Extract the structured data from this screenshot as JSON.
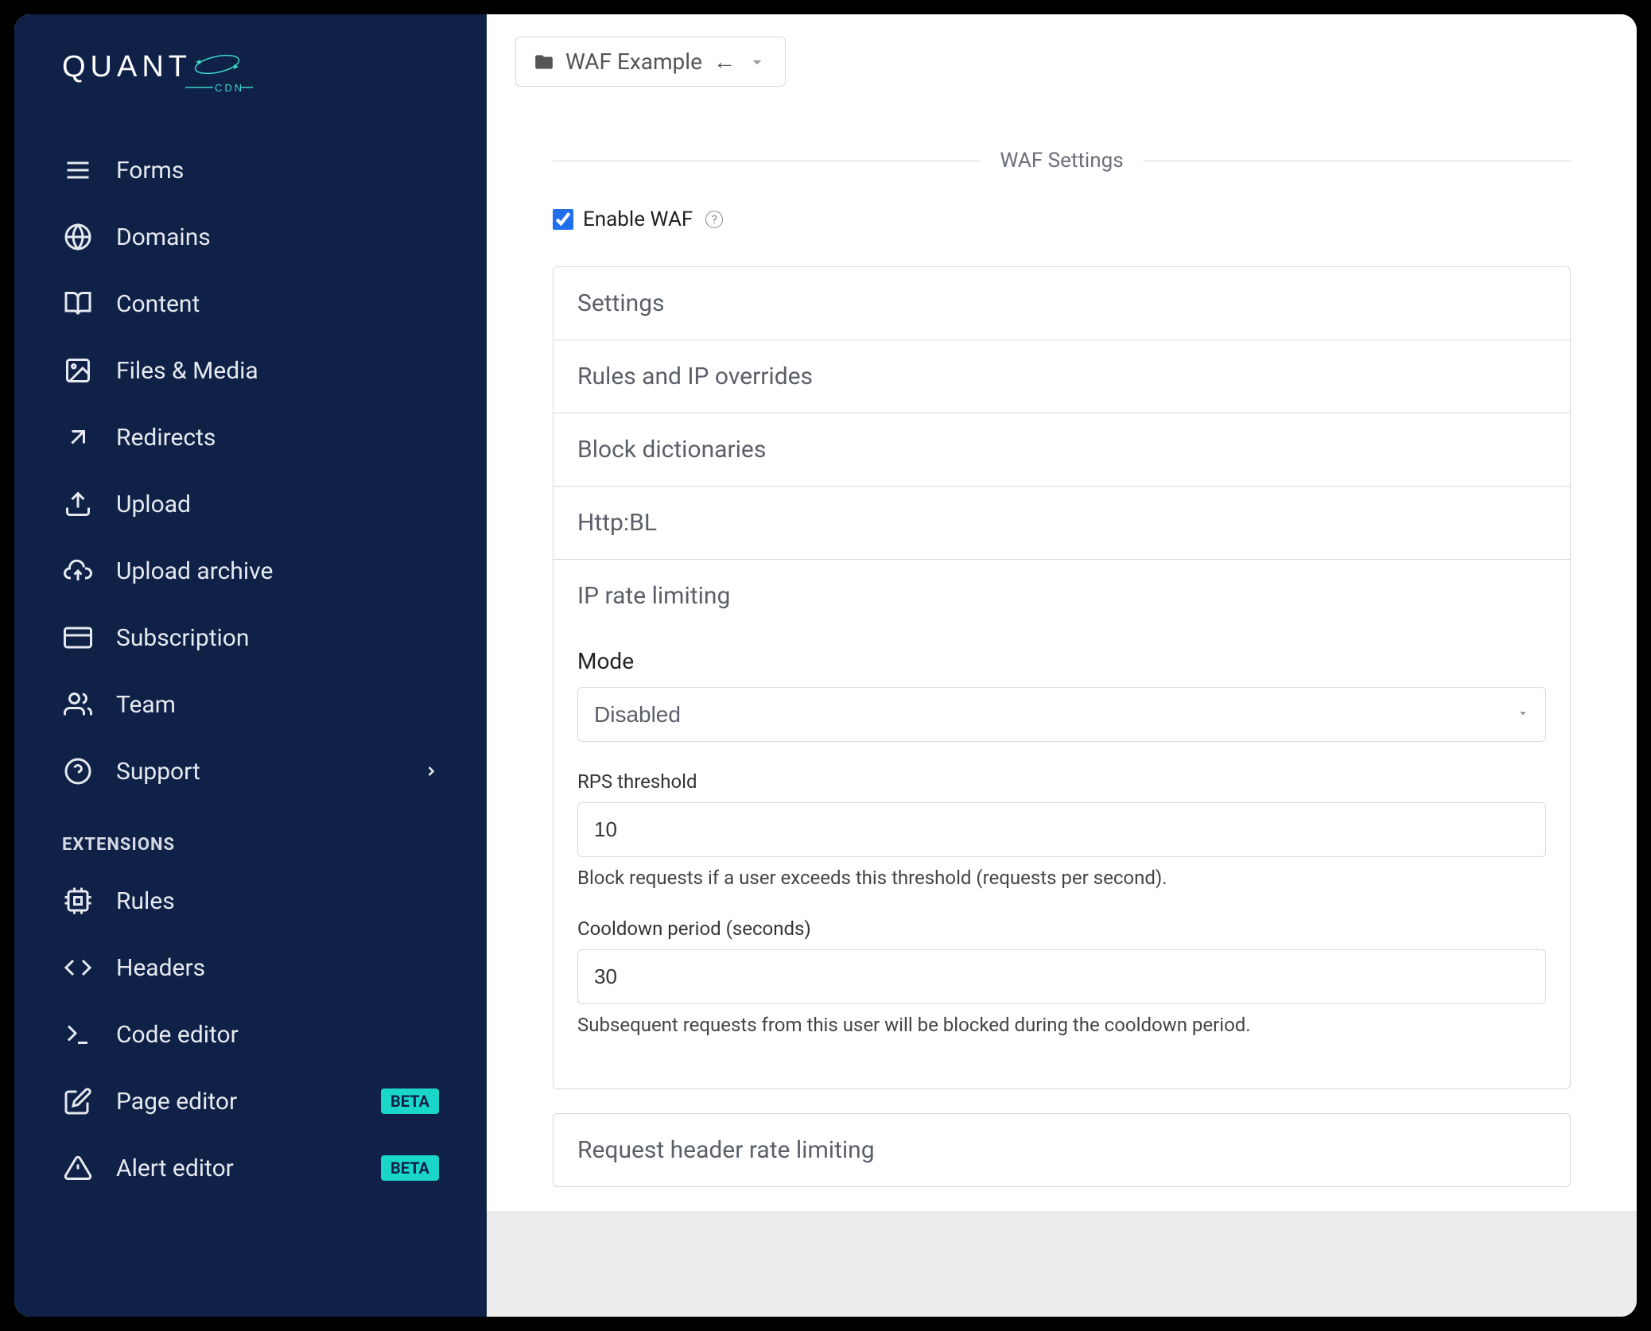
{
  "brand": {
    "name": "QUANT",
    "sub": "CDN"
  },
  "sidebar": {
    "items": [
      {
        "label": "Forms",
        "icon": "menu"
      },
      {
        "label": "Domains",
        "icon": "globe"
      },
      {
        "label": "Content",
        "icon": "book"
      },
      {
        "label": "Files & Media",
        "icon": "image"
      },
      {
        "label": "Redirects",
        "icon": "arrow-up-right"
      },
      {
        "label": "Upload",
        "icon": "upload"
      },
      {
        "label": "Upload archive",
        "icon": "cloud-upload"
      },
      {
        "label": "Subscription",
        "icon": "credit-card"
      },
      {
        "label": "Team",
        "icon": "users"
      },
      {
        "label": "Support",
        "icon": "help-circle",
        "chevron": true
      }
    ],
    "extensions_header": "EXTENSIONS",
    "extensions": [
      {
        "label": "Rules",
        "icon": "cpu"
      },
      {
        "label": "Headers",
        "icon": "code"
      },
      {
        "label": "Code editor",
        "icon": "terminal"
      },
      {
        "label": "Page editor",
        "icon": "edit",
        "badge": "BETA"
      },
      {
        "label": "Alert editor",
        "icon": "alert-triangle",
        "badge": "BETA"
      }
    ]
  },
  "project_selector": {
    "label": "WAF Example",
    "arrow": "←"
  },
  "waf": {
    "legend": "WAF Settings",
    "enable_label": "Enable WAF",
    "enable_checked": true,
    "sections": [
      {
        "title": "Settings"
      },
      {
        "title": "Rules and IP overrides"
      },
      {
        "title": "Block dictionaries"
      },
      {
        "title": "Http:BL"
      },
      {
        "title": "IP rate limiting",
        "expanded": true,
        "fields": {
          "mode_label": "Mode",
          "mode_value": "Disabled",
          "rps_label": "RPS threshold",
          "rps_value": "10",
          "rps_help": "Block requests if a user exceeds this threshold (requests per second).",
          "cooldown_label": "Cooldown period (seconds)",
          "cooldown_value": "30",
          "cooldown_help": "Subsequent requests from this user will be blocked during the cooldown period."
        }
      }
    ],
    "secondary_panel_title": "Request header rate limiting"
  }
}
